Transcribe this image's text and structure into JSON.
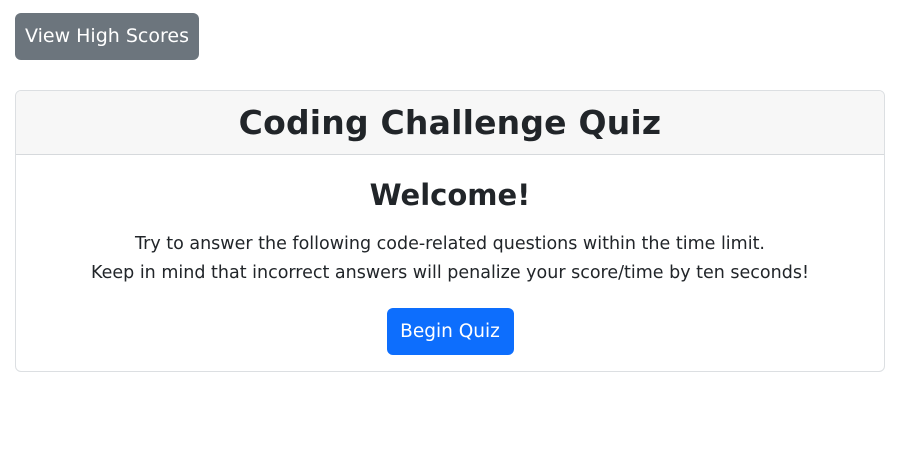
{
  "nav": {
    "high_scores_label": "View High Scores"
  },
  "card": {
    "title": "Coding Challenge Quiz",
    "welcome": "Welcome!",
    "instructions": [
      "Try to answer the following code-related questions within the time limit.",
      "Keep in mind that incorrect answers will penalize your score/time by ten seconds!"
    ],
    "begin_label": "Begin Quiz"
  },
  "colors": {
    "secondary_button": "#6c757d",
    "primary_button": "#0d6efd",
    "card_header_bg": "#f7f7f7",
    "card_border": "#dcdfe2",
    "text": "#212529"
  }
}
